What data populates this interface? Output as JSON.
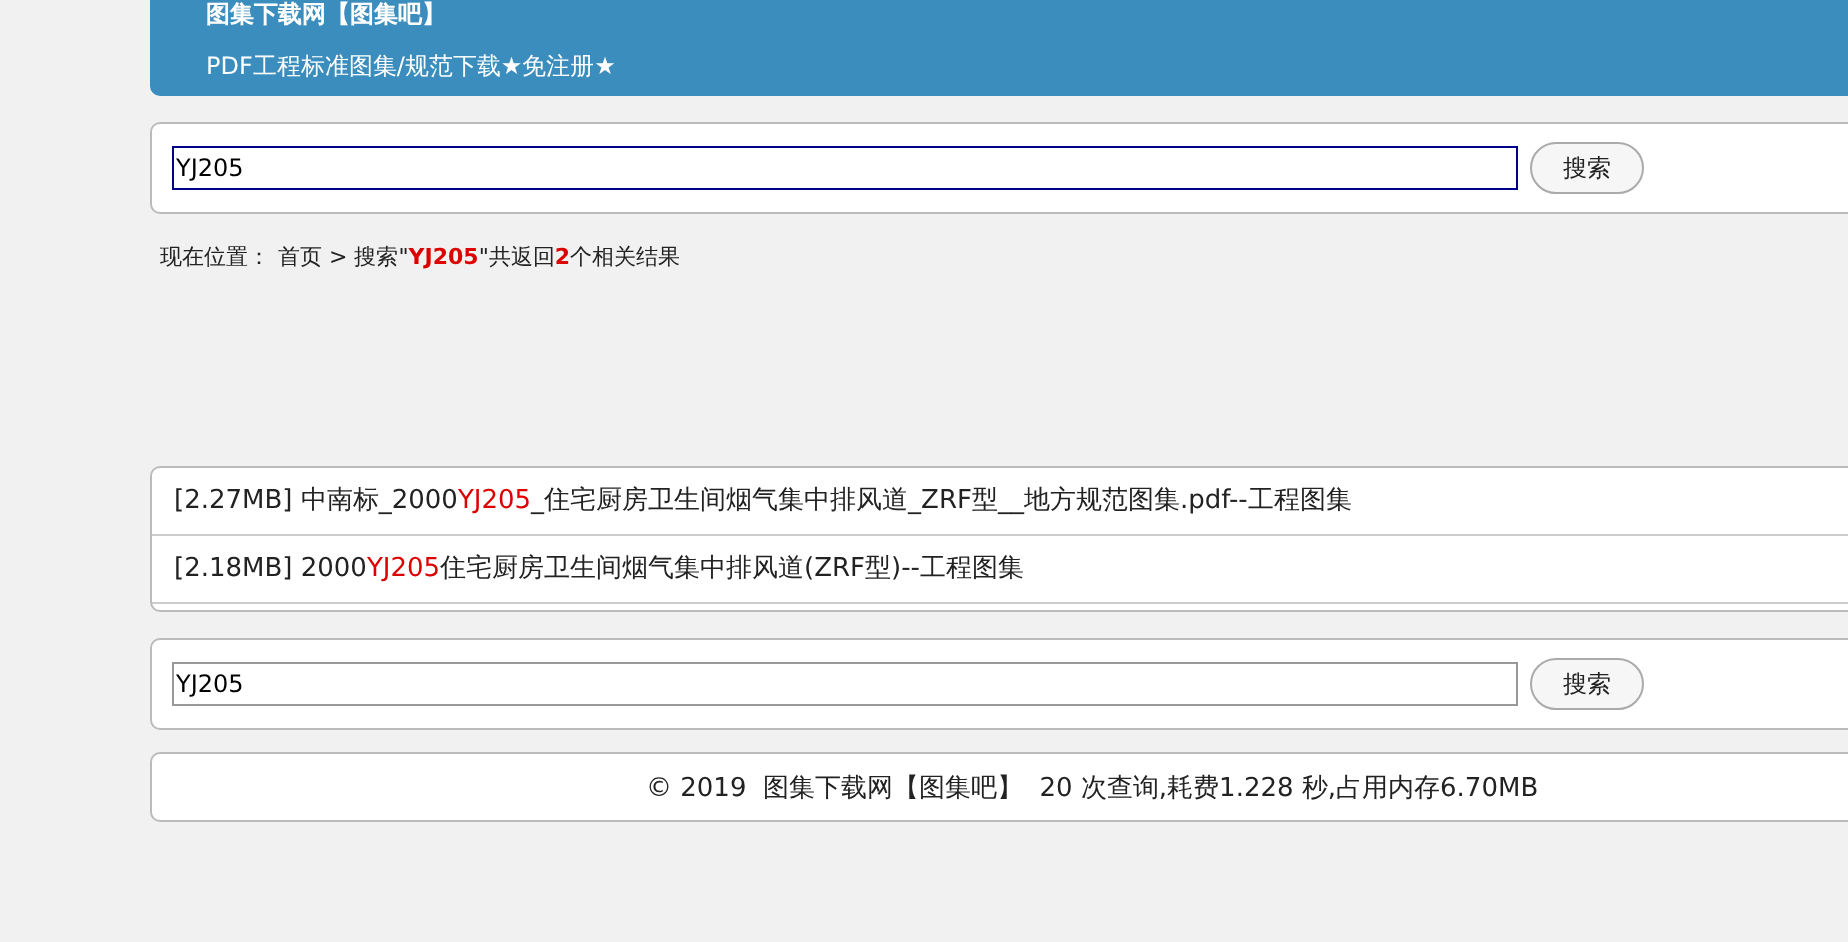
{
  "header": {
    "title": "图集下载网【图集吧】",
    "subtitle": "PDF工程标准图集/规范下载★免注册★"
  },
  "search_top": {
    "value": "YJ205",
    "focused": true,
    "button": "搜索"
  },
  "breadcrumb": {
    "label": "现在位置：",
    "home": "首页",
    "parts": [
      {
        "kind": "text",
        "text": " > 搜索\""
      },
      {
        "kind": "highlight",
        "text": "YJ205"
      },
      {
        "kind": "text",
        "text": "\"共返回"
      },
      {
        "kind": "highlight",
        "text": "2"
      },
      {
        "kind": "text",
        "text": "个相关结果"
      }
    ]
  },
  "results": [
    {
      "parts": [
        {
          "kind": "text",
          "text": "[2.27MB] 中南标_2000"
        },
        {
          "kind": "highlight",
          "text": "YJ205"
        },
        {
          "kind": "text",
          "text": "_住宅厨房卫生间烟气集中排风道_ZRF型__地方规范图集.pdf--工程图集"
        }
      ]
    },
    {
      "parts": [
        {
          "kind": "text",
          "text": "[2.18MB] 2000"
        },
        {
          "kind": "highlight",
          "text": "YJ205"
        },
        {
          "kind": "text",
          "text": "住宅厨房卫生间烟气集中排风道(ZRF型)--工程图集"
        }
      ]
    }
  ],
  "search_bottom": {
    "value": "YJ205",
    "focused": false,
    "button": "搜索"
  },
  "footer": "© 2019  图集下载网【图集吧】  20 次查询,耗费1.228 秒,占用内存6.70MB"
}
